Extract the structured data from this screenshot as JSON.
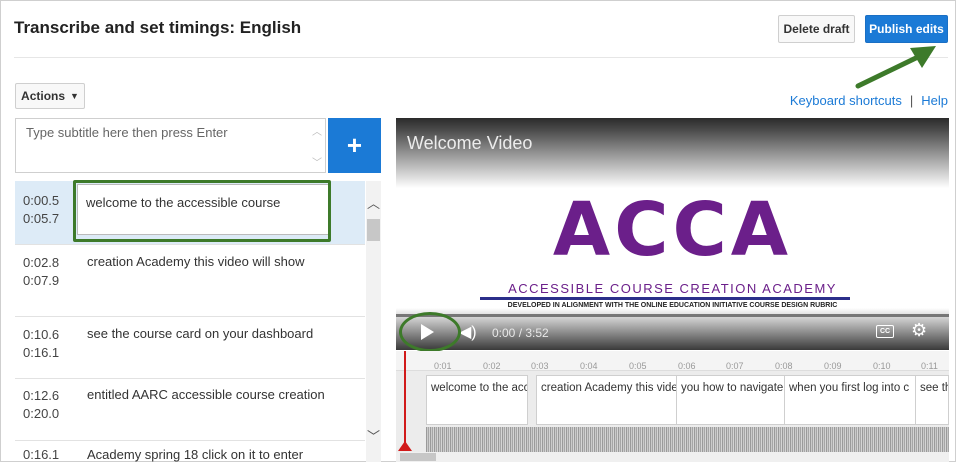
{
  "header": {
    "title": "Transcribe and set timings: English",
    "delete_label": "Delete draft",
    "publish_label": "Publish edits"
  },
  "toolbar": {
    "actions_label": "Actions",
    "keyboard_shortcuts": "Keyboard shortcuts",
    "separator": "|",
    "help": "Help"
  },
  "subtitle_input": {
    "placeholder": "Type subtitle here then press Enter",
    "add_label": "+"
  },
  "subtitles": [
    {
      "start": "0:00.5",
      "end": "0:05.7",
      "text": "welcome to the accessible course"
    },
    {
      "start": "0:02.8",
      "end": "0:07.9",
      "text": "creation Academy this video will show"
    },
    {
      "start": "0:10.6",
      "end": "0:16.1",
      "text": "see the course card on your dashboard"
    },
    {
      "start": "0:12.6",
      "end": "0:20.0",
      "text": "entitled AARC accessible course creation"
    },
    {
      "start": "0:16.1",
      "end": "",
      "text": "Academy spring 18 click on it to enter"
    }
  ],
  "video": {
    "title": "Welcome Video",
    "logo": "ACCA",
    "logo_subtitle": "ACCESSIBLE COURSE CREATION ACADEMY",
    "logo_tagline": "DEVELOPED IN ALIGNMENT WITH THE ONLINE EDUCATION INITIATIVE COURSE DESIGN RUBRIC",
    "time": "0:00 / 3:52",
    "cc_label": "CC"
  },
  "timeline": {
    "ticks": [
      "0:01",
      "0:02",
      "0:03",
      "0:04",
      "0:05",
      "0:06",
      "0:07",
      "0:08",
      "0:09",
      "0:10",
      "0:11"
    ],
    "captions": [
      "welcome to the acce",
      "creation Academy this vide",
      "you how to navigate",
      "when you first log into c",
      "see th"
    ]
  },
  "colors": {
    "accent": "#1b7ad6",
    "highlight": "#3d7a2a",
    "playhead": "#d11a1a",
    "logo": "#6b1f8a"
  },
  "icons": {
    "actions_caret": "caret-down-icon",
    "add": "plus-icon",
    "play": "play-icon",
    "volume": "volume-icon",
    "cc": "cc-icon",
    "settings": "gear-icon"
  }
}
